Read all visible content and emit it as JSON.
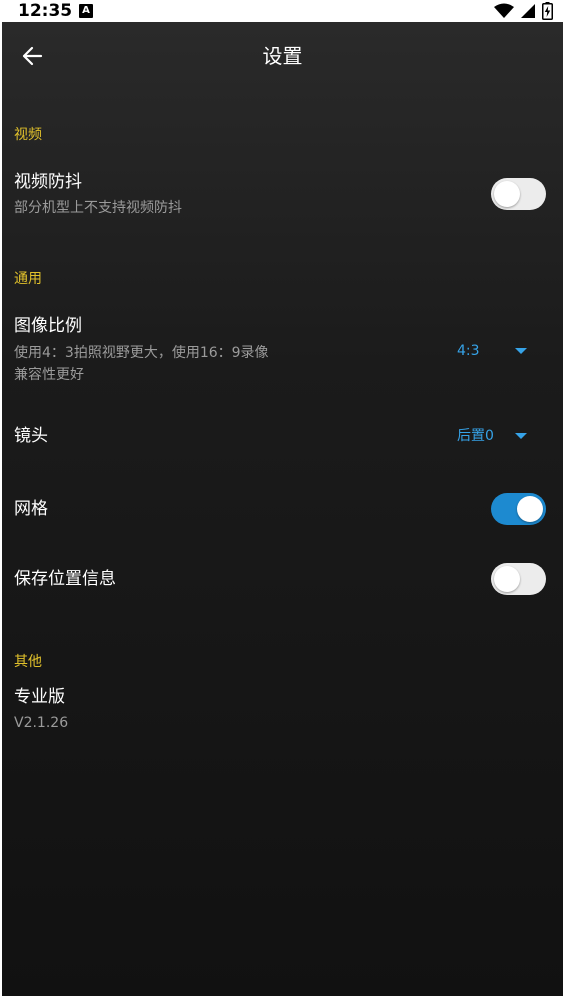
{
  "status_bar": {
    "time": "12:35",
    "notification_badge": "A",
    "icons": [
      "wifi-icon",
      "signal-icon",
      "battery-charging-icon"
    ]
  },
  "app_bar": {
    "title": "设置",
    "back_icon": "arrow-left-icon"
  },
  "sections": {
    "video": {
      "header": "视频",
      "stabilization": {
        "title": "视频防抖",
        "summary": "部分机型上不支持视频防抖",
        "enabled": false
      }
    },
    "general": {
      "header": "通用",
      "aspect_ratio": {
        "title": "图像比例",
        "summary_line1": "使用4：3拍照视野更大，使用16：9录像",
        "summary_line2": "兼容性更好",
        "value": "4:3"
      },
      "lens": {
        "title": "镜头",
        "value": "后置0"
      },
      "grid": {
        "title": "网格",
        "enabled": true
      },
      "save_location": {
        "title": "保存位置信息",
        "enabled": false
      }
    },
    "other": {
      "header": "其他",
      "pro_version": {
        "title": "专业版",
        "summary": "V2.1.26"
      }
    }
  },
  "colors": {
    "accent": "#1d8ad0",
    "section_header": "#e1c12b",
    "spinner_text": "#36a3e8"
  }
}
